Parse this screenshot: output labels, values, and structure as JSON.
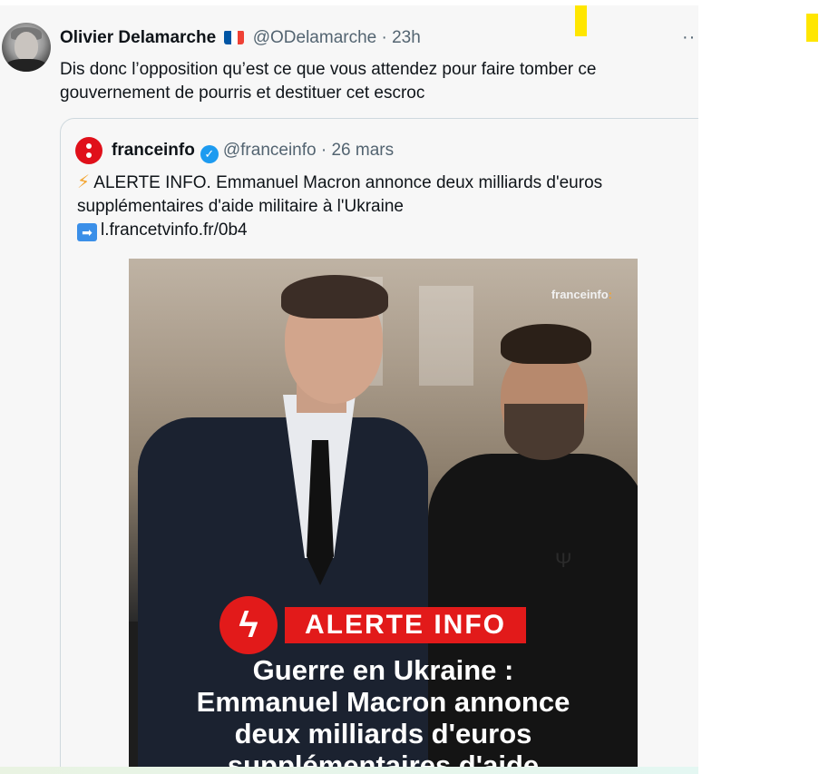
{
  "tweet": {
    "author_name": "Olivier Delamarche",
    "flag_icon": "france-flag",
    "handle": "@ODelamarche",
    "time": "· 23h",
    "text": "Dis donc l’opposition qu’est ce que vous attendez pour faire tomber ce gouvernement de pourris et destituer cet escroc",
    "more_label": "··"
  },
  "quote": {
    "author_name": "franceinfo",
    "verified_icon": "verified-badge-icon",
    "handle": "@franceinfo",
    "time": "· 26 mars",
    "bolt_icon": "⚡",
    "text": "ALERTE INFO. Emmanuel Macron annonce deux milliards d'euros supplémentaires d'aide militaire à l'Ukraine",
    "link_icon": "➡",
    "link": "l.francetvinfo.fr/0b4",
    "media": {
      "watermark_prefix": "franceinfo",
      "watermark_suffix": ":",
      "alert_label": "ALERTE INFO",
      "headline_line1": "Guerre en Ukraine :",
      "headline_line2": "Emmanuel Macron annonce",
      "headline_line3": "deux milliards d'euros",
      "headline_line4": "supplémentaires d'aide"
    }
  },
  "colors": {
    "accent": "#1d9bf0",
    "alert_red": "#e21a1a",
    "marker_yellow": "#ffe600"
  }
}
